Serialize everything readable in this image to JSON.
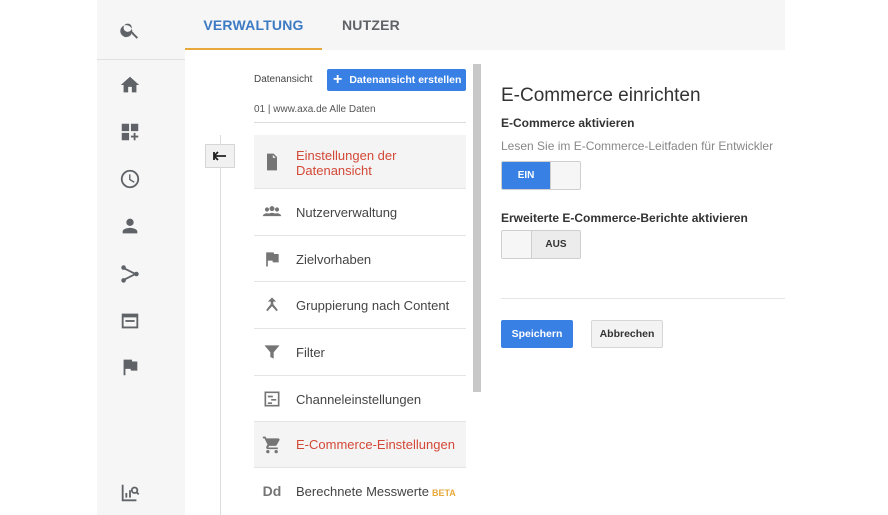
{
  "tabs": [
    {
      "label": "VERWALTUNG",
      "active": true
    },
    {
      "label": "NUTZER",
      "active": false
    }
  ],
  "rail": {
    "icons": [
      "search-icon",
      "home-icon",
      "dashboard-add-icon",
      "clock-icon",
      "person-icon",
      "flow-icon",
      "display-icon",
      "flag-icon",
      "reports-search-icon"
    ]
  },
  "view": {
    "label": "Datenansicht",
    "create_button": "Datenansicht erstellen",
    "name": "01 | www.axa.de Alle Daten"
  },
  "menu": {
    "items": [
      {
        "label": "Einstellungen der Datenansicht",
        "icon": "document-icon",
        "active": true
      },
      {
        "label": "Nutzerverwaltung",
        "icon": "people-icon",
        "active": false
      },
      {
        "label": "Zielvorhaben",
        "icon": "flag-icon",
        "active": false
      },
      {
        "label": "Gruppierung nach Content",
        "icon": "merge-icon",
        "active": false
      },
      {
        "label": "Filter",
        "icon": "filter-icon",
        "active": false
      },
      {
        "label": "Channeleinstellungen",
        "icon": "channel-icon",
        "active": false
      },
      {
        "label": "E-Commerce-Einstellungen",
        "icon": "cart-icon",
        "active": true
      },
      {
        "label": "Berechnete Messwerte",
        "icon": "dd-icon",
        "badge": "BETA",
        "active": false
      }
    ]
  },
  "panel": {
    "title": "E-Commerce einrichten",
    "ecommerce_label": "E-Commerce aktivieren",
    "description": "Lesen Sie im E-Commerce-Leitfaden für Entwickler",
    "toggle_on_label": "EIN",
    "enhanced_label": "Erweiterte E-Commerce-Berichte aktivieren",
    "toggle_off_label": "AUS",
    "save": "Speichern",
    "cancel": "Abbrechen"
  },
  "colors": {
    "accent_blue": "#3880e4",
    "tab_active": "#3c7ac4",
    "tab_underline": "#e8a93b",
    "active_red": "#d34836"
  }
}
